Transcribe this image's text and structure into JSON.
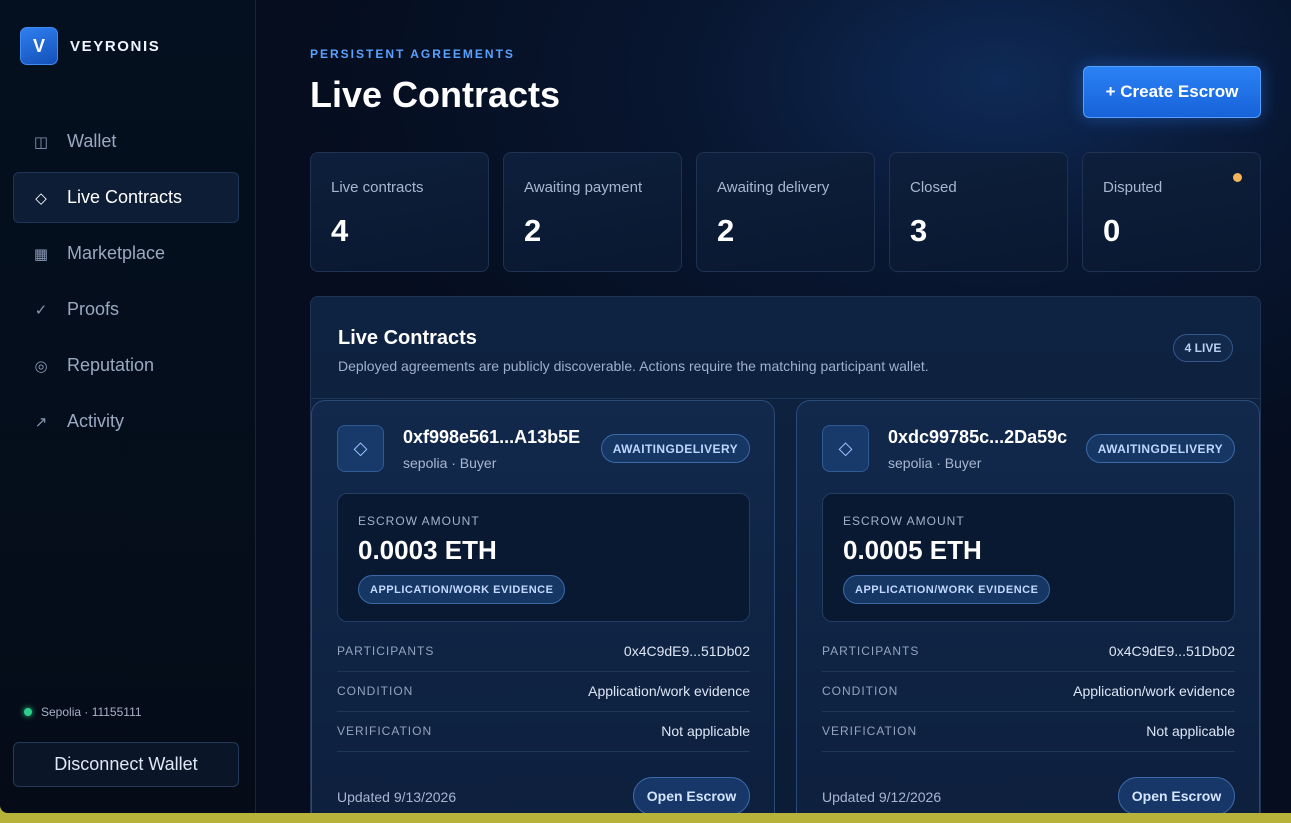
{
  "brand": {
    "logo_letter": "V",
    "name": "VEYRONIS"
  },
  "sidebar": {
    "items": [
      {
        "label": "Wallet",
        "icon": "wallet-icon",
        "glyph": "◫",
        "active": false
      },
      {
        "label": "Live Contracts",
        "icon": "diamond-icon",
        "glyph": "◇",
        "active": true
      },
      {
        "label": "Marketplace",
        "icon": "grid-icon",
        "glyph": "▦",
        "active": false
      },
      {
        "label": "Proofs",
        "icon": "check-icon",
        "glyph": "✓",
        "active": false
      },
      {
        "label": "Reputation",
        "icon": "target-icon",
        "glyph": "◎",
        "active": false
      },
      {
        "label": "Activity",
        "icon": "arrow-up-right-icon",
        "glyph": "↗",
        "active": false
      }
    ],
    "network": "Sepolia · 11155111",
    "disconnect_label": "Disconnect Wallet"
  },
  "header": {
    "eyebrow": "PERSISTENT AGREEMENTS",
    "title": "Live Contracts",
    "create_label": "+ Create Escrow"
  },
  "stats": [
    {
      "label": "Live contracts",
      "value": "4"
    },
    {
      "label": "Awaiting payment",
      "value": "2"
    },
    {
      "label": "Awaiting delivery",
      "value": "2"
    },
    {
      "label": "Closed",
      "value": "3"
    },
    {
      "label": "Disputed",
      "value": "0"
    }
  ],
  "panel": {
    "title": "Live Contracts",
    "subtitle": "Deployed agreements are publicly discoverable. Actions require the matching participant wallet.",
    "badge": "4 LIVE"
  },
  "contracts": [
    {
      "address": "0xf998e561...A13b5E",
      "meta": "sepolia · Buyer",
      "status": "AWAITINGDELIVERY",
      "amount_label": "ESCROW AMOUNT",
      "amount": "0.0003 ETH",
      "tag": "APPLICATION/WORK EVIDENCE",
      "rows": [
        {
          "key": "PARTICIPANTS",
          "value": "0x4C9dE9...51Db02"
        },
        {
          "key": "CONDITION",
          "value": "Application/work evidence"
        },
        {
          "key": "VERIFICATION",
          "value": "Not applicable"
        }
      ],
      "updated": "Updated 9/13/2026",
      "open_label": "Open Escrow"
    },
    {
      "address": "0xdc99785c...2Da59c",
      "meta": "sepolia · Buyer",
      "status": "AWAITINGDELIVERY",
      "amount_label": "ESCROW AMOUNT",
      "amount": "0.0005 ETH",
      "tag": "APPLICATION/WORK EVIDENCE",
      "rows": [
        {
          "key": "PARTICIPANTS",
          "value": "0x4C9dE9...51Db02"
        },
        {
          "key": "CONDITION",
          "value": "Application/work evidence"
        },
        {
          "key": "VERIFICATION",
          "value": "Not applicable"
        }
      ],
      "updated": "Updated 9/12/2026",
      "open_label": "Open Escrow"
    }
  ],
  "colors": {
    "accent": "#2b82f5",
    "status_ok": "#2ecf8a",
    "status_warn": "#f4b45a"
  }
}
